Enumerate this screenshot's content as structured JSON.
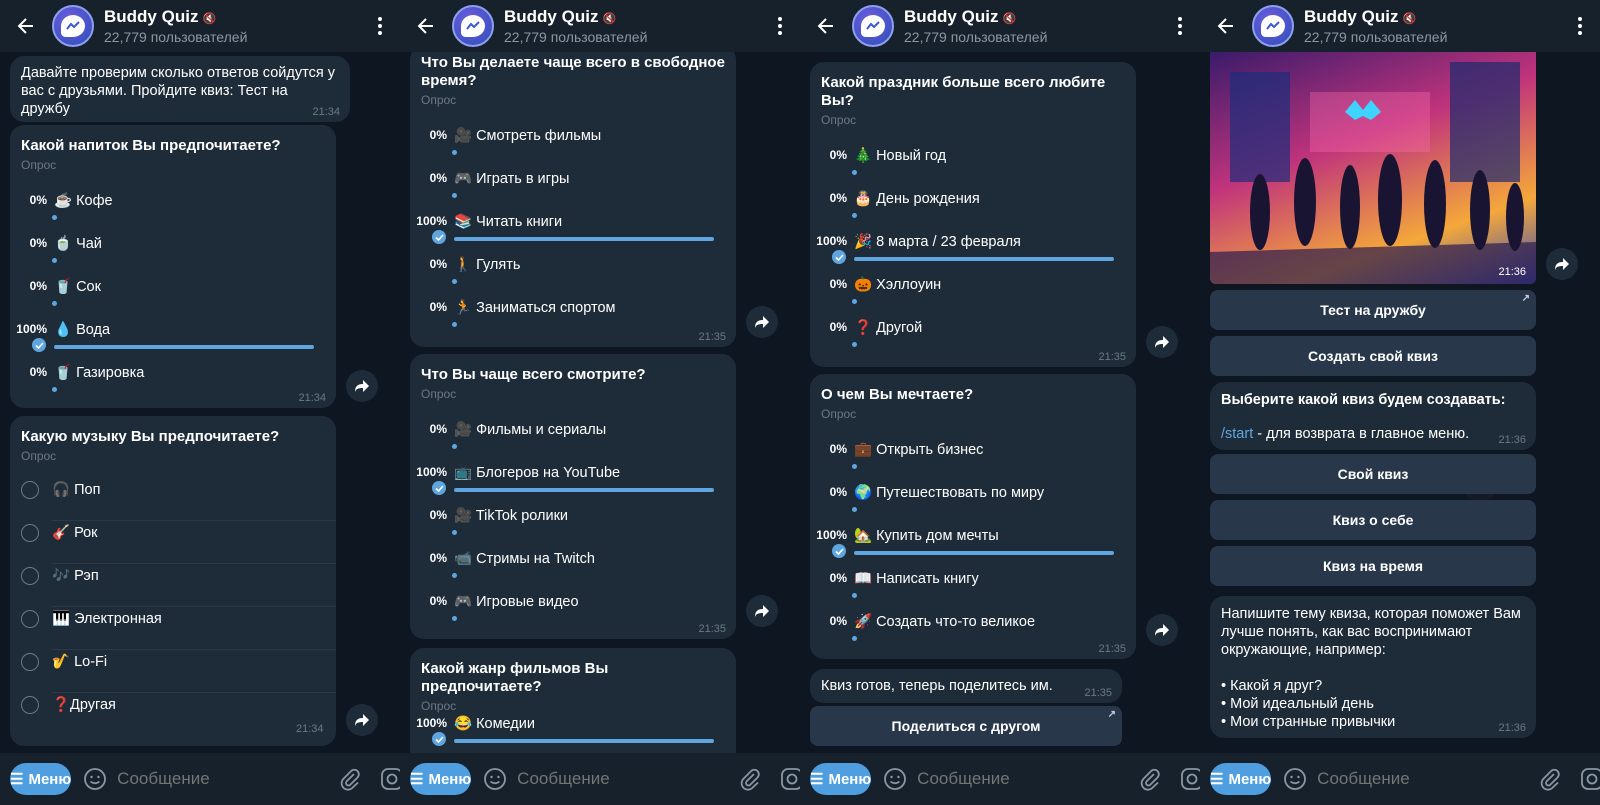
{
  "header": {
    "title": "Buddy Quiz",
    "subtitle": "22,779 пользователей"
  },
  "composer": {
    "menu_label": "Меню",
    "placeholder": "Сообщение"
  },
  "panel1": {
    "intro": "Давайте проверим сколько ответов сойдутся у вас с друзьями. Пройдите квиз: Тест на дружбу",
    "intro_time": "21:34",
    "poll1": {
      "question": "Какой напиток Вы предпочитаете?",
      "type": "Опрос",
      "time": "21:34",
      "options": [
        {
          "pct": "0%",
          "text": "☕ Кофе",
          "value": 0
        },
        {
          "pct": "0%",
          "text": "🍵 Чай",
          "value": 0
        },
        {
          "pct": "0%",
          "text": "🥤 Сок",
          "value": 0
        },
        {
          "pct": "100%",
          "text": "💧 Вода",
          "value": 100
        },
        {
          "pct": "0%",
          "text": "🥤 Газировка",
          "value": 0
        }
      ]
    },
    "poll2": {
      "question": "Какую музыку Вы предпочитаете?",
      "type": "Опрос",
      "time": "21:34",
      "options": [
        "🎧 Поп",
        "🎸 Рок",
        "🎶 Рэп",
        "🎹 Электронная",
        "🎷 Lo-Fi",
        "❓Другая"
      ]
    }
  },
  "panel2": {
    "poll1": {
      "question": "Что Вы делаете чаще всего в свободное время?",
      "type": "Опрос",
      "time": "21:35",
      "options": [
        {
          "pct": "0%",
          "text": "🎥 Смотреть фильмы",
          "value": 0
        },
        {
          "pct": "0%",
          "text": "🎮 Играть в игры",
          "value": 0
        },
        {
          "pct": "100%",
          "text": "📚 Читать книги",
          "value": 100
        },
        {
          "pct": "0%",
          "text": "🚶 Гулять",
          "value": 0
        },
        {
          "pct": "0%",
          "text": "🏃 Заниматься спортом",
          "value": 0
        }
      ]
    },
    "poll2": {
      "question": "Что Вы чаще всего смотрите?",
      "type": "Опрос",
      "time": "21:35",
      "options": [
        {
          "pct": "0%",
          "text": "🎥 Фильмы и сериалы",
          "value": 0
        },
        {
          "pct": "100%",
          "text": "📺 Блогеров на YouTube",
          "value": 100
        },
        {
          "pct": "0%",
          "text": "🎥 TikTok ролики",
          "value": 0
        },
        {
          "pct": "0%",
          "text": "📹 Стримы на Twitch",
          "value": 0
        },
        {
          "pct": "0%",
          "text": "🎮 Игровые видео",
          "value": 0
        }
      ]
    },
    "poll3": {
      "question": "Какой жанр фильмов Вы предпочитаете?",
      "type": "Опрос",
      "options": [
        {
          "pct": "100%",
          "text": "😂 Комедии",
          "value": 100
        }
      ]
    }
  },
  "panel3": {
    "poll1": {
      "question": "Какой праздник больше всего любите Вы?",
      "type": "Опрос",
      "time": "21:35",
      "options": [
        {
          "pct": "0%",
          "text": "🎄 Новый год",
          "value": 0
        },
        {
          "pct": "0%",
          "text": "🎂 День рождения",
          "value": 0
        },
        {
          "pct": "100%",
          "text": "🎉 8 марта / 23 февраля",
          "value": 100
        },
        {
          "pct": "0%",
          "text": "🎃 Хэллоуин",
          "value": 0
        },
        {
          "pct": "0%",
          "text": "❓ Другой",
          "value": 0
        }
      ]
    },
    "poll2": {
      "question": "О чем Вы мечтаете?",
      "type": "Опрос",
      "time": "21:35",
      "options": [
        {
          "pct": "0%",
          "text": "💼 Открыть бизнес",
          "value": 0
        },
        {
          "pct": "0%",
          "text": "🌍 Путешествовать по миру",
          "value": 0
        },
        {
          "pct": "100%",
          "text": "🏡 Купить дом мечты",
          "value": 100
        },
        {
          "pct": "0%",
          "text": "📖 Написать книгу",
          "value": 0
        },
        {
          "pct": "0%",
          "text": "🚀 Создать что-то великое",
          "value": 0
        }
      ]
    },
    "ready_text": "Квиз готов, теперь поделитесь им.",
    "ready_time": "21:35",
    "share_button": "Поделиться с другом"
  },
  "panel4": {
    "image_time": "21:36",
    "buttons1": [
      "Тест на дружбу",
      "Создать свой квиз"
    ],
    "choose_text": "Выберите какой квиз будем создавать:",
    "start_cmd": "/start",
    "start_desc": " - для возврата в главное меню.",
    "choose_time": "21:36",
    "buttons2": [
      "Свой квиз",
      "Квиз о себе",
      "Квиз на время"
    ],
    "topic_text": "Напишите тему квиза, которая поможет Вам лучше понять, как вас воспринимают окружающие, например:",
    "topic_items": [
      "• Какой я друг?",
      "• Мой идеальный день",
      "• Мои странные привычки"
    ],
    "topic_time": "21:36"
  }
}
